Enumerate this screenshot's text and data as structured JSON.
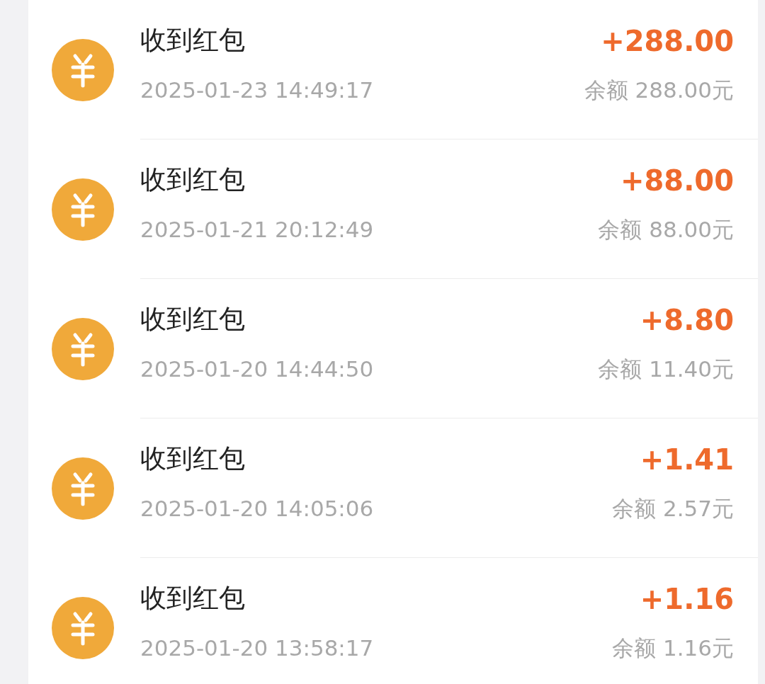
{
  "transactions": [
    {
      "title": "收到红包",
      "time": "2025-01-23 14:49:17",
      "amount": "+288.00",
      "balance": "余额 288.00元"
    },
    {
      "title": "收到红包",
      "time": "2025-01-21 20:12:49",
      "amount": "+88.00",
      "balance": "余额 88.00元"
    },
    {
      "title": "收到红包",
      "time": "2025-01-20 14:44:50",
      "amount": "+8.80",
      "balance": "余额 11.40元"
    },
    {
      "title": "收到红包",
      "time": "2025-01-20 14:05:06",
      "amount": "+1.41",
      "balance": "余额 2.57元"
    },
    {
      "title": "收到红包",
      "time": "2025-01-20 13:58:17",
      "amount": "+1.16",
      "balance": "余额 1.16元"
    }
  ]
}
